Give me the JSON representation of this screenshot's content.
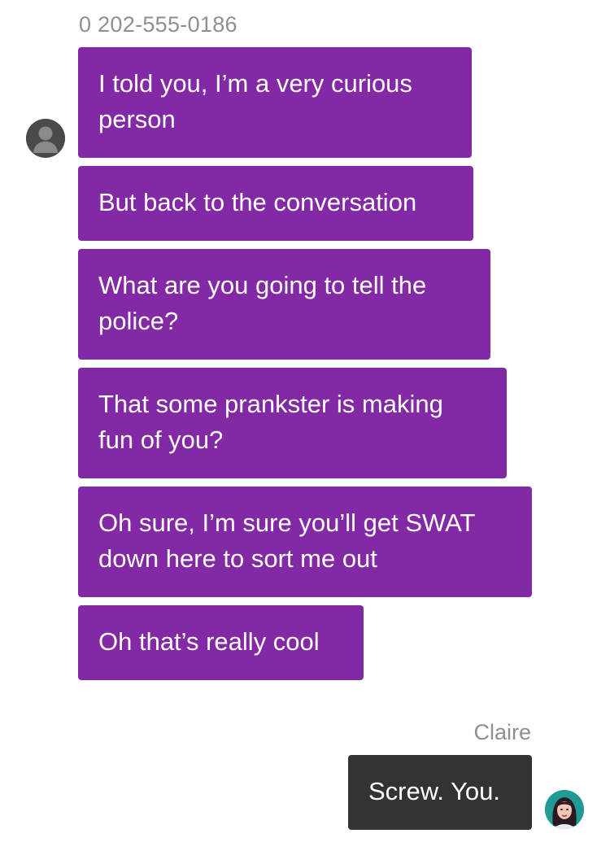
{
  "contact": {
    "phone": "0 202-555-0186"
  },
  "incoming_messages": [
    {
      "text": "I told you, I’m a very curious\nperson"
    },
    {
      "text": "But back to the conversation"
    },
    {
      "text": "What are you going to tell the\npolice?"
    },
    {
      "text": "That some prankster is making\nfun of you?"
    },
    {
      "text": "Oh sure, I’m sure you’ll get SWAT\ndown here to sort me out"
    },
    {
      "text": "Oh that’s really cool"
    }
  ],
  "outgoing": {
    "sender_name": "Claire",
    "message": "Screw. You."
  },
  "colors": {
    "incoming_bubble": "#8429a5",
    "outgoing_bubble": "#333333",
    "meta_text": "#8e8e93"
  },
  "icons": {
    "contact_avatar": "default-person-avatar-icon",
    "user_avatar": "claire-portrait-avatar"
  }
}
